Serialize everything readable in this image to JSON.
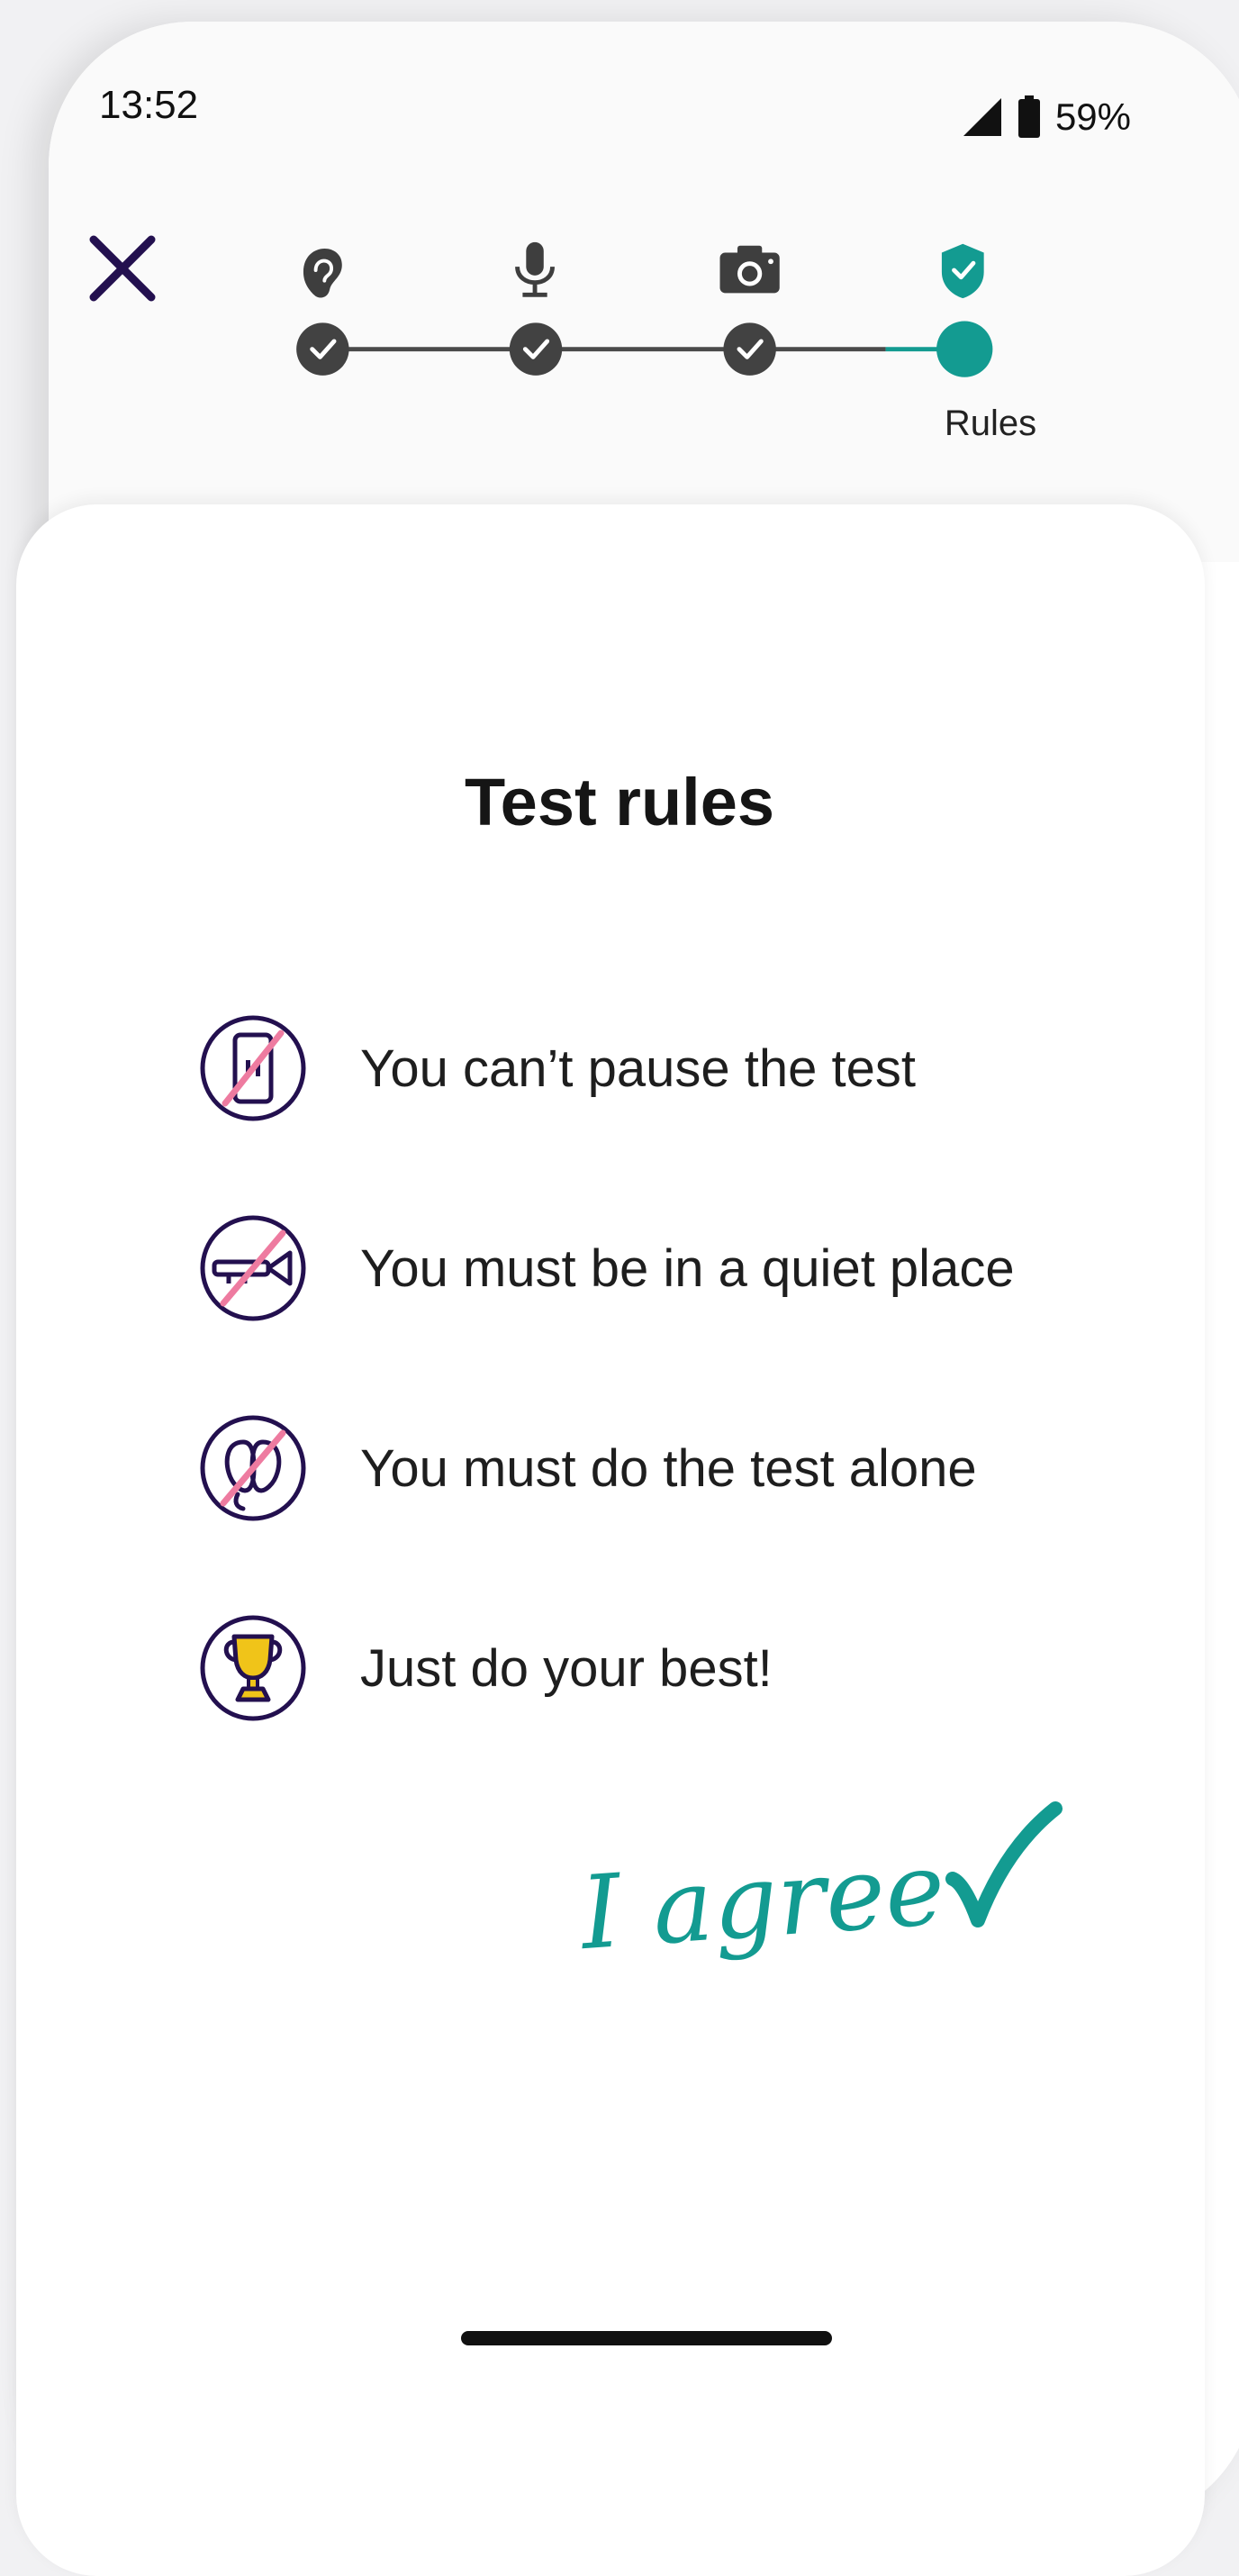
{
  "status_bar": {
    "time": "13:52",
    "battery": "59%"
  },
  "stepper": {
    "steps": [
      {
        "icon": "ear-icon",
        "state": "done"
      },
      {
        "icon": "microphone-icon",
        "state": "done"
      },
      {
        "icon": "camera-icon",
        "state": "done"
      },
      {
        "icon": "shield-check-icon",
        "state": "current"
      }
    ],
    "current_label": "Rules"
  },
  "main": {
    "title": "Test rules",
    "rules": [
      {
        "icon": "no-pause-icon",
        "text": "You can’t pause the test"
      },
      {
        "icon": "no-noise-icon",
        "text": "You must be in a quiet place"
      },
      {
        "icon": "no-company-icon",
        "text": "You must do the test alone"
      },
      {
        "icon": "trophy-icon",
        "text": "Just do your best!"
      }
    ],
    "agree_label": "I agree"
  },
  "colors": {
    "accent": "#139b91",
    "brand_purple": "#23104f",
    "strike_pink": "#ee7ba0",
    "gold": "#f0c419",
    "step_done": "#424242"
  }
}
